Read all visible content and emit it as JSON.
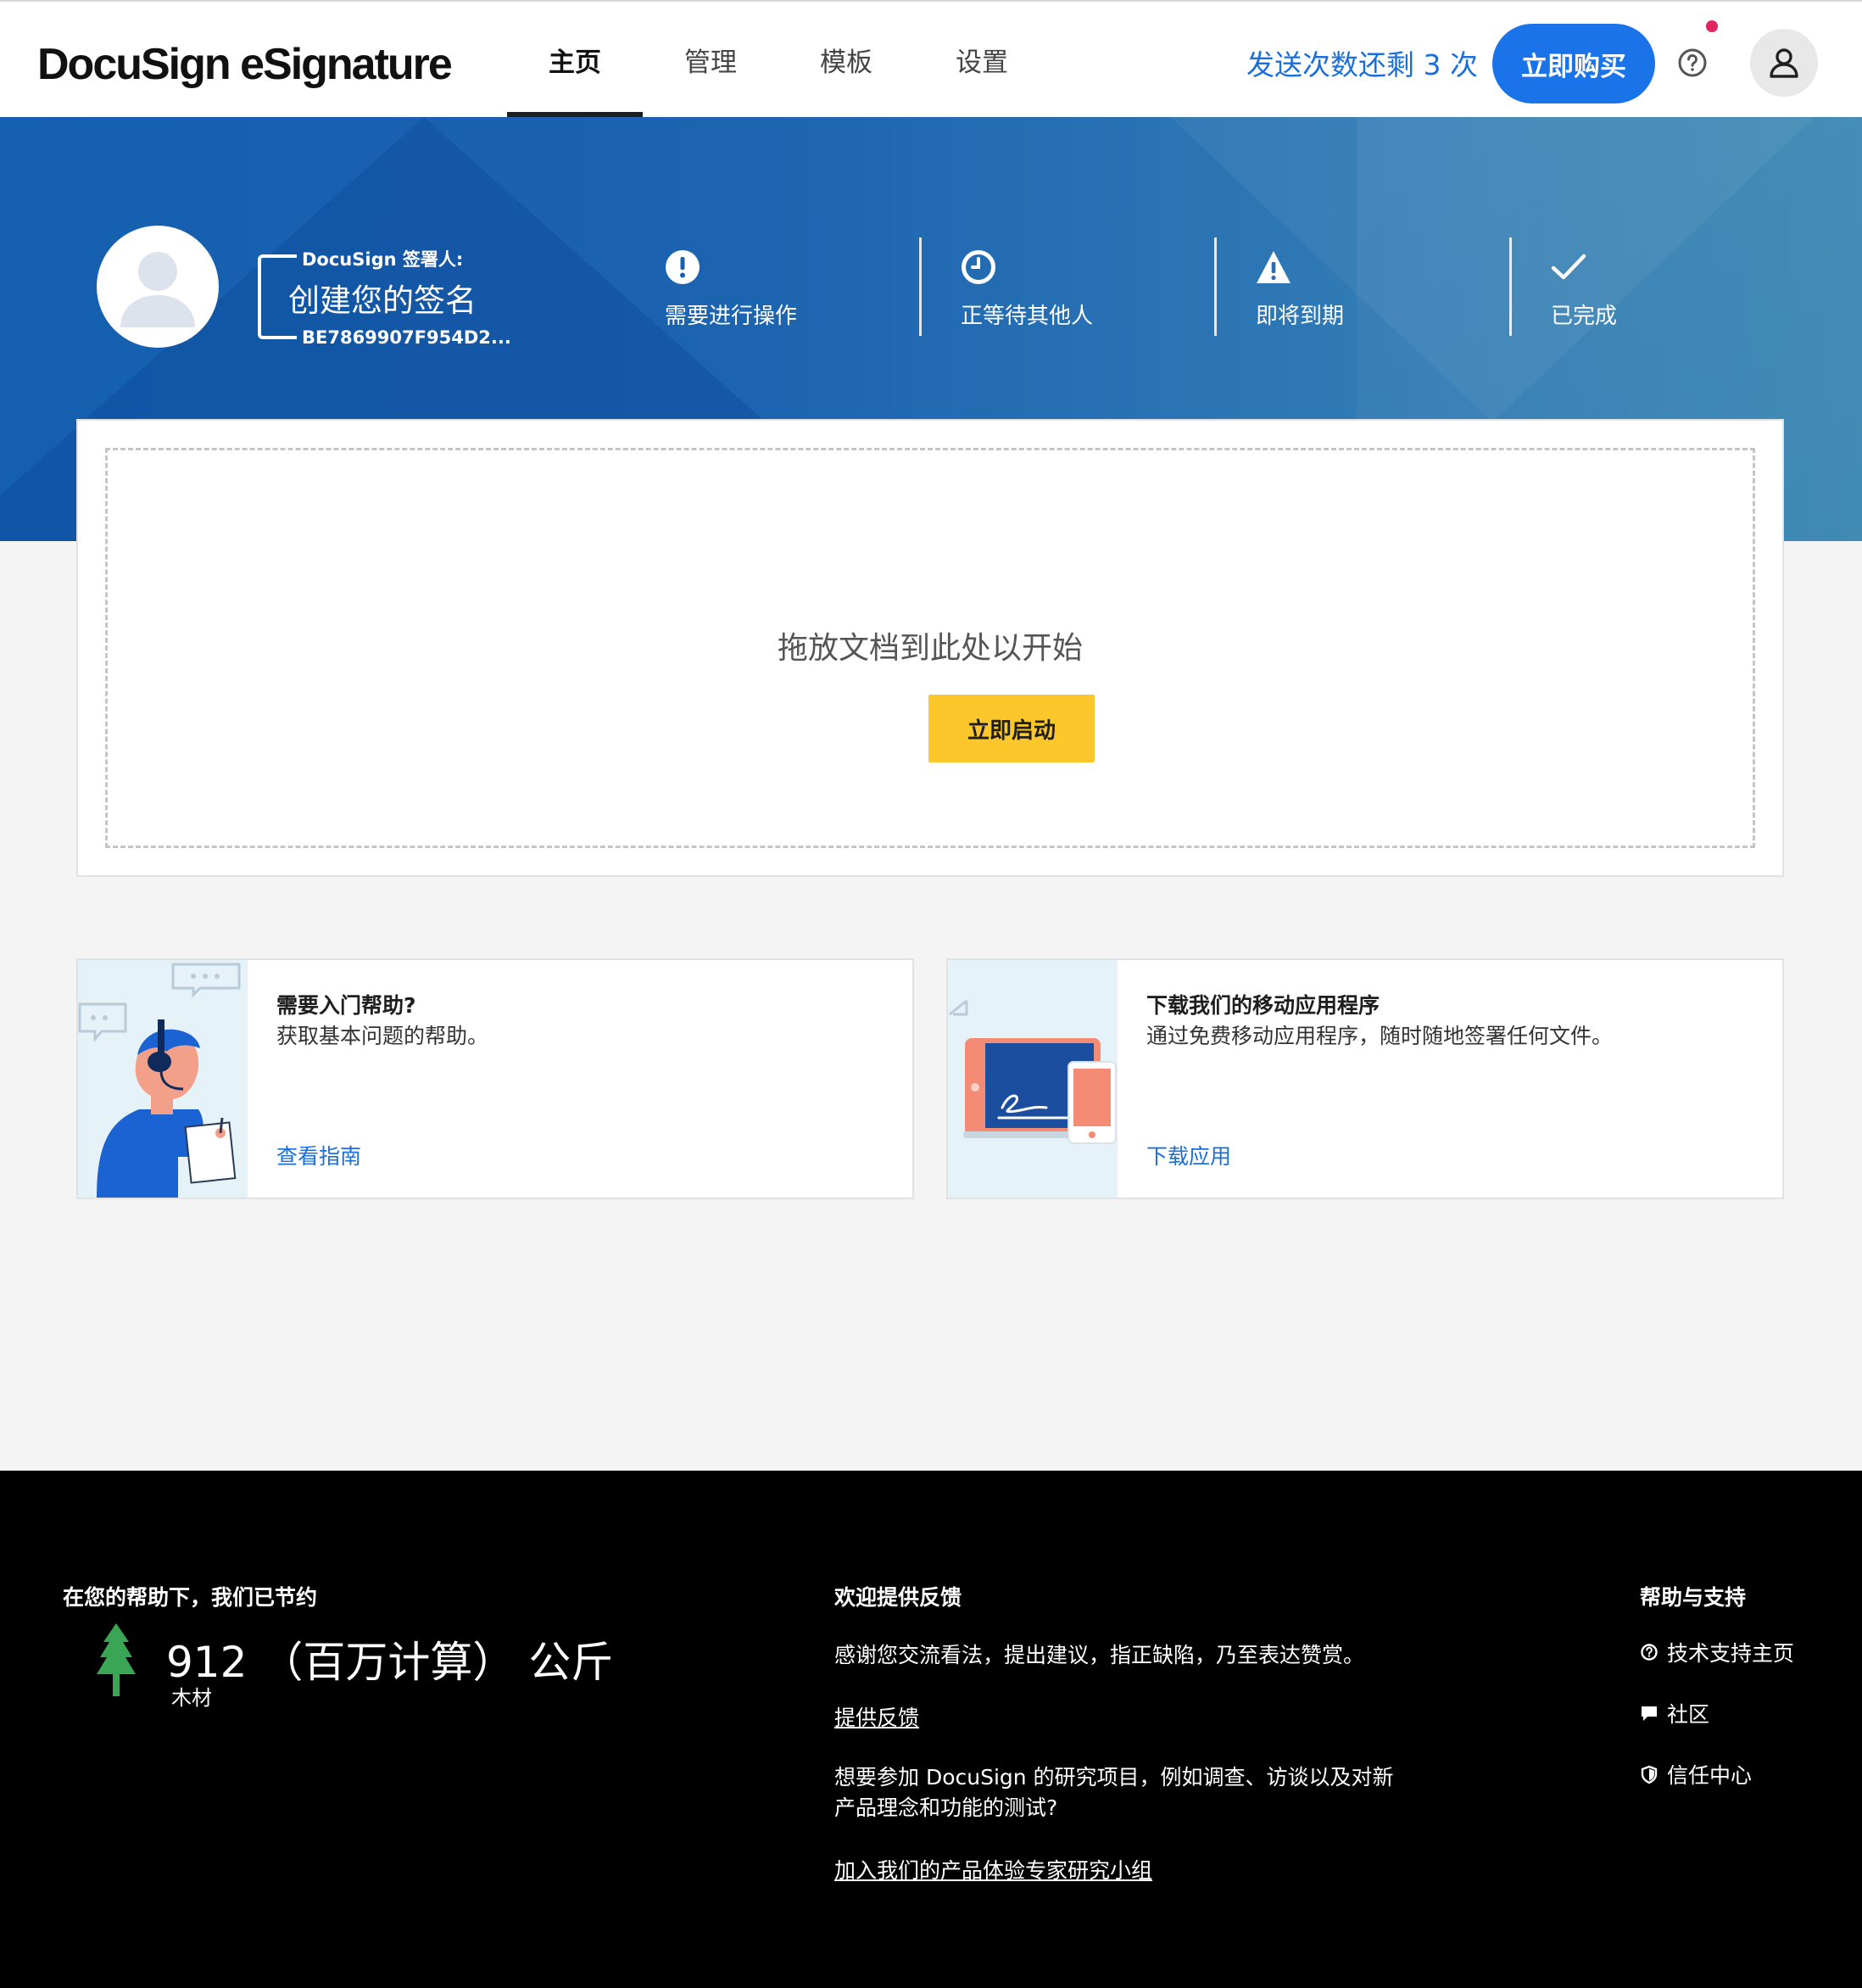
{
  "header": {
    "logo": "DocuSign eSignature",
    "nav": [
      {
        "label": "主页",
        "active": true
      },
      {
        "label": "管理",
        "active": false
      },
      {
        "label": "模板",
        "active": false
      },
      {
        "label": "设置",
        "active": false
      }
    ],
    "remaining_sends": "发送次数还剩 3 次",
    "buy_button": "立即购买"
  },
  "hero": {
    "signer_label": "DocuSign 签署人:",
    "signature_title": "创建您的签名",
    "signer_id": "BE7869907F954D2...",
    "stats": [
      {
        "label": "需要进行操作",
        "icon": "exclamation-icon"
      },
      {
        "label": "正等待其他人",
        "icon": "clock-icon"
      },
      {
        "label": "即将到期",
        "icon": "warning-icon"
      },
      {
        "label": "已完成",
        "icon": "check-icon"
      }
    ]
  },
  "dropzone": {
    "text": "拖放文档到此处以开始",
    "start_button": "立即启动"
  },
  "cards": [
    {
      "title": "需要入门帮助?",
      "desc": "获取基本问题的帮助。",
      "link": "查看指南"
    },
    {
      "title": "下载我们的移动应用程序",
      "desc": "通过免费移动应用程序，随时随地签署任何文件。",
      "link": "下载应用"
    }
  ],
  "footer": {
    "savings": {
      "heading": "在您的帮助下，我们已节约",
      "amount": "912 （百万计算） 公斤",
      "unit": "木材"
    },
    "feedback": {
      "heading": "欢迎提供反馈",
      "text": "感谢您交流看法，提出建议，指正缺陷，乃至表达赞赏。",
      "link": "提供反馈",
      "research_text_1": "想要参加 DocuSign 的研究项目，例如调查、访谈以及对新",
      "research_text_2": "产品理念和功能的测试?",
      "research_link": "加入我们的产品体验专家研究小组"
    },
    "support": {
      "heading": "帮助与支持",
      "items": [
        {
          "label": "技术支持主页",
          "icon": "help-circle-icon"
        },
        {
          "label": "社区",
          "icon": "chat-icon"
        },
        {
          "label": "信任中心",
          "icon": "shield-icon"
        }
      ]
    }
  },
  "colors": {
    "brand_blue": "#1a73e8",
    "link_blue": "#1a6fdb",
    "start_yellow": "#fcc72a",
    "hero_blue": "#155fb0",
    "footer_black": "#000000",
    "tree_green": "#3aa655",
    "notification_red": "#e0245e"
  }
}
